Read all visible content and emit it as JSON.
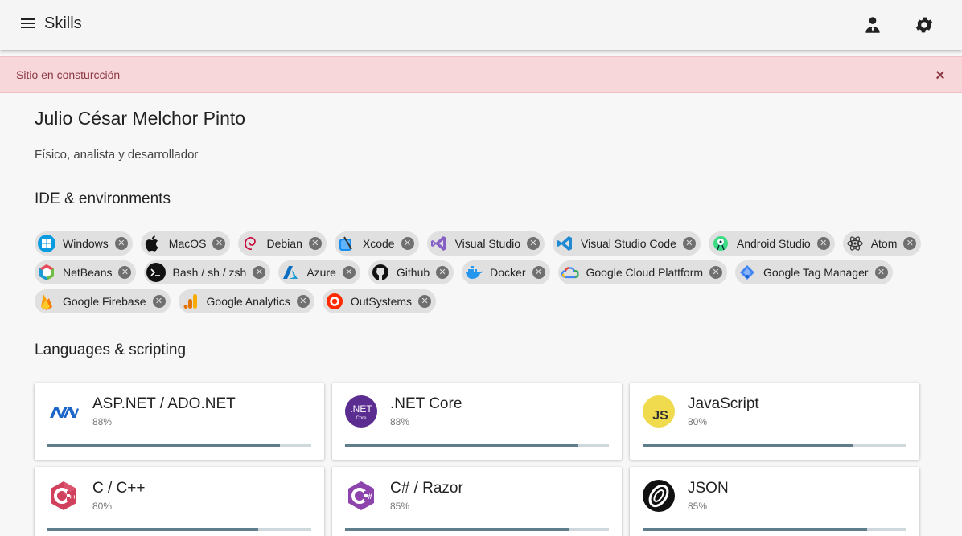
{
  "appbar": {
    "title": "Skills",
    "menu_icon": "menu-icon",
    "user_icon": "user-icon",
    "settings_icon": "gear-icon"
  },
  "alert": {
    "text": "Sitio en consturcción",
    "close_icon": "close-icon"
  },
  "profile": {
    "name": "Julio César Melchor Pinto",
    "subtitle": "Físico, analista y desarrollador"
  },
  "sections": {
    "ide_title": "IDE & environments",
    "lang_title": "Languages & scripting"
  },
  "chips": [
    {
      "label": "Windows",
      "icon": "windows-icon"
    },
    {
      "label": "MacOS",
      "icon": "apple-icon"
    },
    {
      "label": "Debian",
      "icon": "debian-icon"
    },
    {
      "label": "Xcode",
      "icon": "xcode-icon"
    },
    {
      "label": "Visual Studio",
      "icon": "visual-studio-icon"
    },
    {
      "label": "Visual Studio Code",
      "icon": "vscode-icon"
    },
    {
      "label": "Android Studio",
      "icon": "android-studio-icon"
    },
    {
      "label": "Atom",
      "icon": "atom-icon"
    },
    {
      "label": "NetBeans",
      "icon": "netbeans-icon"
    },
    {
      "label": "Bash / sh / zsh",
      "icon": "terminal-icon"
    },
    {
      "label": "Azure",
      "icon": "azure-icon"
    },
    {
      "label": "Github",
      "icon": "github-icon"
    },
    {
      "label": "Docker",
      "icon": "docker-icon"
    },
    {
      "label": "Google Cloud Plattform",
      "icon": "google-cloud-icon"
    },
    {
      "label": "Google Tag Manager",
      "icon": "tag-manager-icon"
    },
    {
      "label": "Google Firebase",
      "icon": "firebase-icon"
    },
    {
      "label": "Google Analytics",
      "icon": "analytics-icon"
    },
    {
      "label": "OutSystems",
      "icon": "outsystems-icon"
    }
  ],
  "skills": [
    {
      "title": "ASP.NET / ADO.NET",
      "pct": "88%",
      "value": 0.88,
      "icon": "aspnet-icon",
      "logo_text": ""
    },
    {
      "title": ".NET Core",
      "pct": "88%",
      "value": 0.88,
      "icon": "dotnet-core-icon",
      "logo_text": ".NET",
      "logo_sub": "Core"
    },
    {
      "title": "JavaScript",
      "pct": "80%",
      "value": 0.8,
      "icon": "javascript-icon",
      "logo_text": "JS"
    },
    {
      "title": "C / C++",
      "pct": "80%",
      "value": 0.8,
      "icon": "cpp-icon",
      "logo_text": "C++"
    },
    {
      "title": "C# / Razor",
      "pct": "85%",
      "value": 0.85,
      "icon": "csharp-icon",
      "logo_text": "C#"
    },
    {
      "title": "JSON",
      "pct": "85%",
      "value": 0.85,
      "icon": "json-icon",
      "logo_text": ""
    }
  ],
  "colors": {
    "accent": "#607d8b",
    "alert_bg": "#f8d7da",
    "chip_bg": "#e0e0e0"
  }
}
